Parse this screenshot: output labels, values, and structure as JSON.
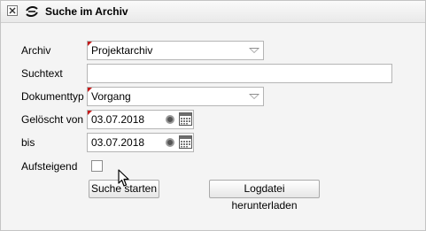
{
  "window": {
    "title": "Suche im Archiv"
  },
  "form": {
    "archiv": {
      "label": "Archiv",
      "value": "Projektarchiv"
    },
    "suchtext": {
      "label": "Suchtext",
      "value": ""
    },
    "dokumenttyp": {
      "label": "Dokumenttyp",
      "value": "Vorgang"
    },
    "geloescht_von": {
      "label": "Gelöscht von",
      "value": "03.07.2018"
    },
    "bis": {
      "label": "bis",
      "value": "03.07.2018"
    },
    "aufsteigend": {
      "label": "Aufsteigend",
      "checked": false
    }
  },
  "buttons": {
    "search": "Suche starten",
    "download_log": "Logdatei herunterladen"
  },
  "colors": {
    "required_marker": "#c41a1a",
    "window_bg": "#f4f4f4"
  },
  "icons": {
    "close": "close-icon",
    "logo": "app-logo-icon",
    "combo": "chevron-down-icon",
    "date_reset": "radio-dot-icon",
    "calendar": "calendar-icon",
    "cursor": "mouse-cursor-icon"
  }
}
